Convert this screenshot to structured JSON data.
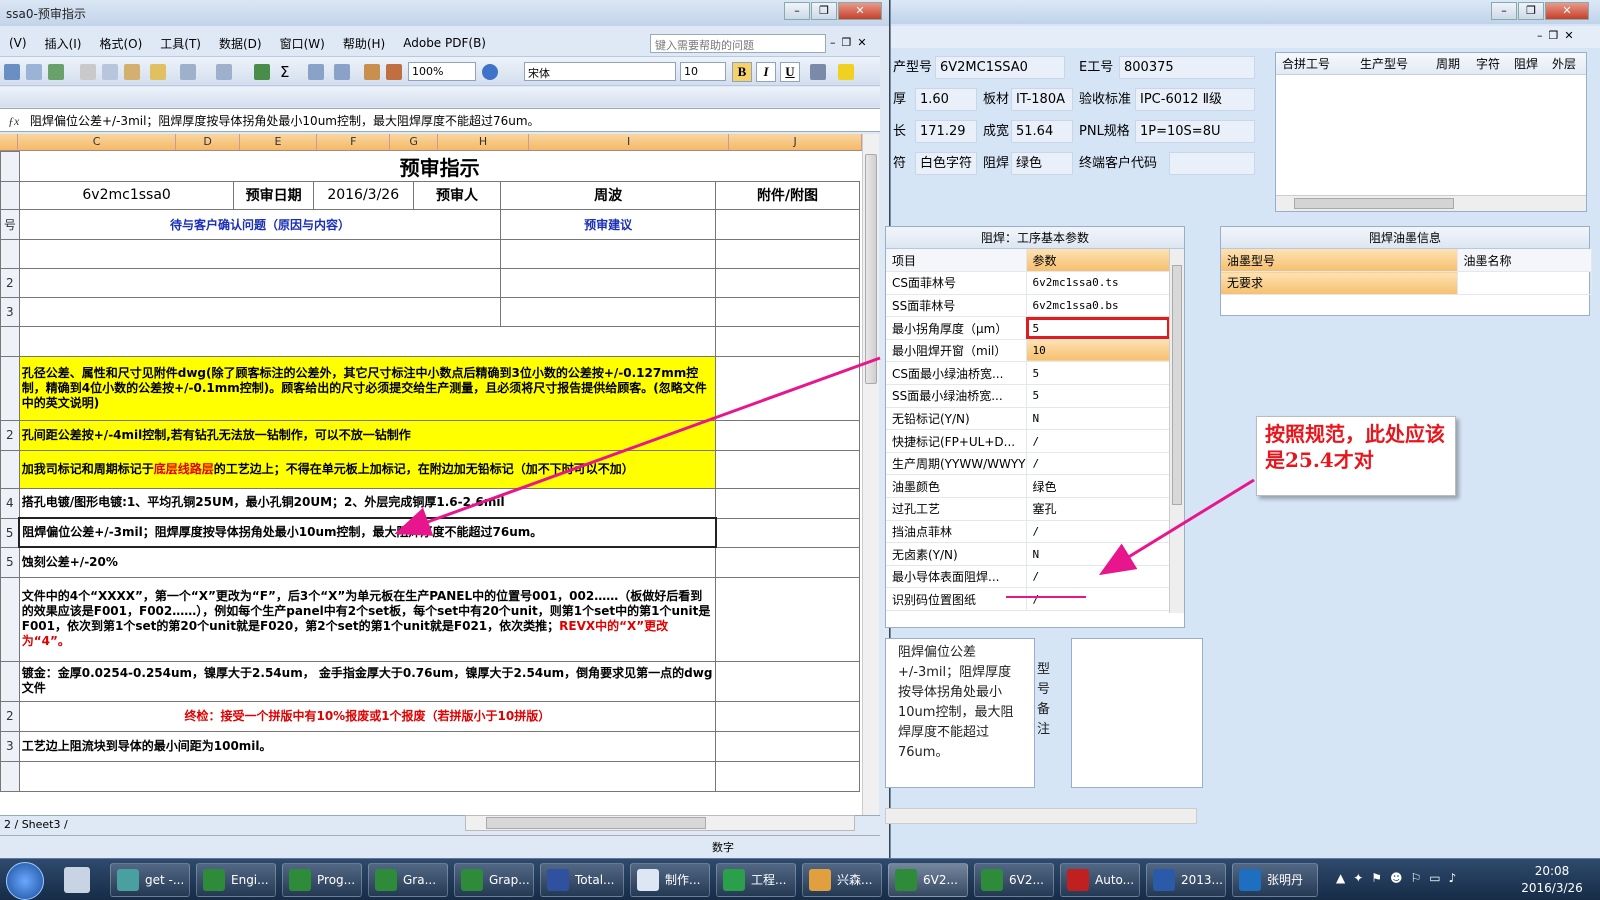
{
  "excel": {
    "title": "ssa0-预审指示",
    "menu": [
      "(V)",
      "插入(I)",
      "格式(O)",
      "工具(T)",
      "数据(D)",
      "窗口(W)",
      "帮助(H)",
      "Adobe PDF(B)"
    ],
    "help_placeholder": "键入需要帮助的问题",
    "zoom": "100%",
    "font": "宋体",
    "font_size": "10",
    "fmt": [
      "B",
      "I",
      "U"
    ],
    "formula": "阻焊偏位公差+/-3mil；阻焊厚度按导体拐角处最小10um控制，最大阻焊厚度不能超过76um。",
    "columns": [
      "C",
      "D",
      "E",
      "F",
      "G",
      "H",
      "I",
      "J"
    ],
    "sheet_title": "预审指示",
    "info": {
      "model": "6v2mc1ssa0",
      "date_label": "预审日期",
      "date": "2016/3/26",
      "reviewer_label": "预审人",
      "reviewer": "周波",
      "attach_label": "附件/附图"
    },
    "hdr": {
      "issues": "待与客户确认问题（原因与内容）",
      "advice": "预审建议"
    },
    "rownums": [
      "号",
      "",
      "2",
      "3",
      "",
      "",
      "2",
      "",
      "4",
      "5",
      "5",
      "",
      "",
      "2",
      "3",
      ""
    ],
    "notes": {
      "n1": "孔径公差、属性和尺寸见附件dwg(除了顾客标注的公差外，其它尺寸标注中小数点后精确到3位小数的公差按+/-0.127mm控制，精确到4位小数的公差按+/-0.1mm控制)。顾客给出的尺寸必须提交给生产测量，且必须将尺寸报告提供给顾客。(忽略文件中的英文说明)",
      "n2": "孔间距公差按+/-4mil控制,若有钻孔无法放一钻制作，可以不放一钻制作",
      "n3a": "加我司标记和周期标记于",
      "n3b": "底层线路层",
      "n3c": "的工艺边上；不得在单元板上加标记，在附边加无铅标记（加不下时可以不加）",
      "n4": "搭孔电镀/图形电镀:1、平均孔铜25UM，最小孔铜20UM；2、外层完成铜厚1.6-2.6mil",
      "n5": "阻焊偏位公差+/-3mil；阻焊厚度按导体拐角处最小10um控制，最大阻焊厚度不能超过76um。",
      "n6": "蚀刻公差+/-20%",
      "n7a": "文件中的4个“XXXX”，第一个“X”更改为“F”，后3个“X”为单元板在生产PANEL中的位置号001，002……（板做好后看到的效果应该是F001，F002……），例如每个生产panel中有2个set板，每个set中有20个unit，则第1个set中的第1个unit是F001，依次到第1个set的第20个unit就是F020，第2个set的第1个unit就是F021，依次类推；",
      "n7b": "REVX中的“X”更改为“4”。",
      "n8": "镀金：金厚0.0254-0.254um，镍厚大于2.54um，  金手指金厚大于0.76um，镍厚大于2.54um，倒角要求见第一点的dwg文件",
      "n9": "终检：接受一个拼版中有10%报废或1个报废（若拼版小于10拼版）",
      "n10": "工艺边上阻流块到导体的最小间距为100mil。"
    },
    "tabs": "2 / Sheet3 /",
    "status": "数字"
  },
  "app": {
    "fields": [
      {
        "label": "产型号",
        "value": "6V2MC1SSA0"
      },
      {
        "label": "E工号",
        "value": "800375"
      },
      {
        "label": "厚",
        "value": "1.60"
      },
      {
        "label": "板材",
        "value": "IT-180A"
      },
      {
        "label": "验收标准",
        "value": "IPC-6012 Ⅱ级"
      },
      {
        "label": "长",
        "value": "171.29"
      },
      {
        "label": "成宽",
        "value": "51.64"
      },
      {
        "label": "PNL规格",
        "value": "1P=10S=8U"
      },
      {
        "label": "符",
        "value": "白色字符"
      },
      {
        "label": "阻焊",
        "value": "绿色"
      },
      {
        "label": "终端客户代码",
        "value": ""
      }
    ],
    "merge_cols": [
      "合拼工号",
      "生产型号",
      "周期",
      "字符",
      "阻焊",
      "外层"
    ],
    "params_title": "阻焊：工序基本参数",
    "params_head": [
      "项目",
      "参数"
    ],
    "params": [
      [
        "CS面菲林号",
        "6v2mc1ssa0.ts"
      ],
      [
        "SS面菲林号",
        "6v2mc1ssa0.bs"
      ],
      [
        "最小拐角厚度（μm）",
        "5"
      ],
      [
        "最小阻焊开窗（mil）",
        "10"
      ],
      [
        "CS面最小绿油桥宽...",
        "5"
      ],
      [
        "SS面最小绿油桥宽...",
        "5"
      ],
      [
        "无铅标记(Y/N)",
        "N"
      ],
      [
        "快捷标记(FP+UL+D...",
        "/"
      ],
      [
        "生产周期(YYWW/WWYY)",
        "/"
      ],
      [
        "油墨颜色",
        "绿色"
      ],
      [
        "过孔工艺",
        "塞孔"
      ],
      [
        "挡油点菲林",
        "/"
      ],
      [
        "无卤素(Y/N)",
        "N"
      ],
      [
        "最小导体表面阻焊...",
        "/"
      ],
      [
        "识别码位置图纸",
        "/"
      ]
    ],
    "ink_title": "阻焊油墨信息",
    "ink_head": [
      "油墨型号",
      "油墨名称"
    ],
    "ink_row": [
      "无要求",
      ""
    ],
    "note": "阻焊偏位公差+/-3mil；阻焊厚度按导体拐角处最小10um控制，最大阻焊厚度不能超过76um。",
    "note_side": "型号备注"
  },
  "callout": "按照规范，此处应该是25.4才对",
  "taskbar": {
    "items": [
      "get -...",
      "Engi...",
      "Prog...",
      "Gra...",
      "Grap...",
      "Total...",
      "制作...",
      "工程...",
      "兴森...",
      "6V2...",
      "6V2...",
      "Auto...",
      "2013...",
      "张明丹"
    ],
    "time": "20:08",
    "date": "2016/3/26"
  },
  "colors": {
    "accent": "#e8168c",
    "highlight": "#ffff00",
    "header_orange": "#f6c06e"
  }
}
